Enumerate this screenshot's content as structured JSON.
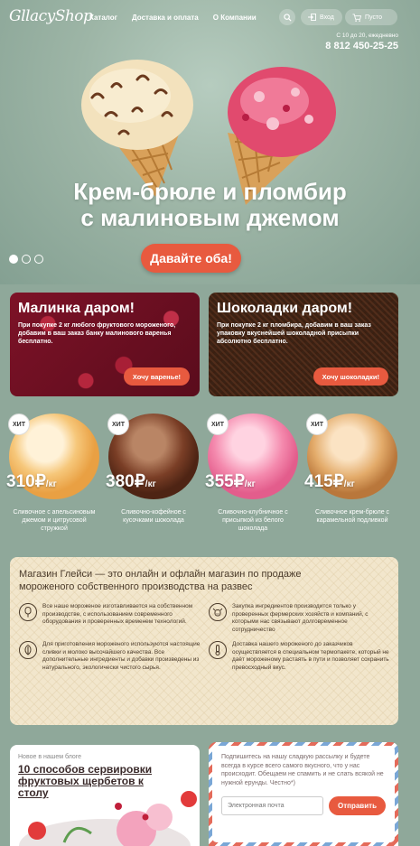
{
  "header": {
    "logo": "GllacyShop",
    "nav": [
      "Каталог",
      "Доставка и оплата",
      "О Компании"
    ],
    "login_label": "Вход",
    "cart_label": "Пусто",
    "hours": "С 10 до 20, ежедневно",
    "phone": "8 812 450-25-25"
  },
  "hero": {
    "title_line1": "Крем-брюле и пломбир",
    "title_line2": "с малиновым джемом",
    "cta": "Давайте оба!",
    "slides": 3,
    "active_slide": 1
  },
  "promos": [
    {
      "title": "Малинка даром!",
      "text": "При покупке 2 кг любого фруктового мороженого, добавим в ваш заказ банку малинового варенья бесплатно.",
      "button": "Хочу варенье!"
    },
    {
      "title": "Шоколадки даром!",
      "text": "При покупке 2 кг пломбира, добавим в ваш заказ упаковку вкуснейшей шоколадной присыпки абсолютно бесплатно.",
      "button": "Хочу шоколадки!"
    }
  ],
  "products": [
    {
      "badge": "ХИТ",
      "price": "310₽",
      "unit": "/кг",
      "name": "Сливочное с апельсиновым джемом и цитрусовой стружкой",
      "color": "#f3b45c"
    },
    {
      "badge": "ХИТ",
      "price": "380₽",
      "unit": "/кг",
      "name": "Сливочно-кофейное с кусочками шоколада",
      "color": "#7a3e26"
    },
    {
      "badge": "ХИТ",
      "price": "355₽",
      "unit": "/кг",
      "name": "Сливочно-клубничное с присыпкой из белого шоколада",
      "color": "#f07aa0"
    },
    {
      "badge": "ХИТ",
      "price": "415₽",
      "unit": "/кг",
      "name": "Сливочное крем-брюле с карамельной подливкой",
      "color": "#d89a5a"
    }
  ],
  "about": {
    "title": "Магазин Глейси — это онлайн и офлайн магазин по продаже мороженого собственного производства на развес",
    "features": [
      {
        "icon": "popsicle-icon",
        "text": "Все наше мороженое изготавливается на собственном производстве, с использованием современного оборудования и проверенных временем технологий."
      },
      {
        "icon": "cow-icon",
        "text": "Закупка ингредиентов производится только у проверенных фермерских хозяйств и компаний, с которыми нас связывают долговременное сотрудничество"
      },
      {
        "icon": "leaf-icon",
        "text": "Для приготовления мороженого используются настоящие сливки и молоко высочайшего качества. Все дополнительные ингредиенты и добавки произведены из натурального, экологически чистого сырья."
      },
      {
        "icon": "thermometer-icon",
        "text": "Доставка нашего мороженого до заказчиков осуществляется в специальном термопакете, который не даёт мороженому растаять в пути и позволяет сохранить превосходный вкус."
      }
    ]
  },
  "blog": {
    "label": "Новое в нашем блоге",
    "title": "10 способов сервировки фруктовых щербетов к столу"
  },
  "newsletter": {
    "text": "Подпишитесь на нашу сладкую рассылку и будете всегда в курсе всего самого вкусного, что у нас происходит. Обещаем не спамить и не слать всякой не нужной ерунды. Честно*)",
    "placeholder": "Электронная почта",
    "button": "Отправить"
  },
  "colors": {
    "accent": "#e85a3f",
    "background": "#8fa89a",
    "about_bg": "#f2e6cc"
  }
}
